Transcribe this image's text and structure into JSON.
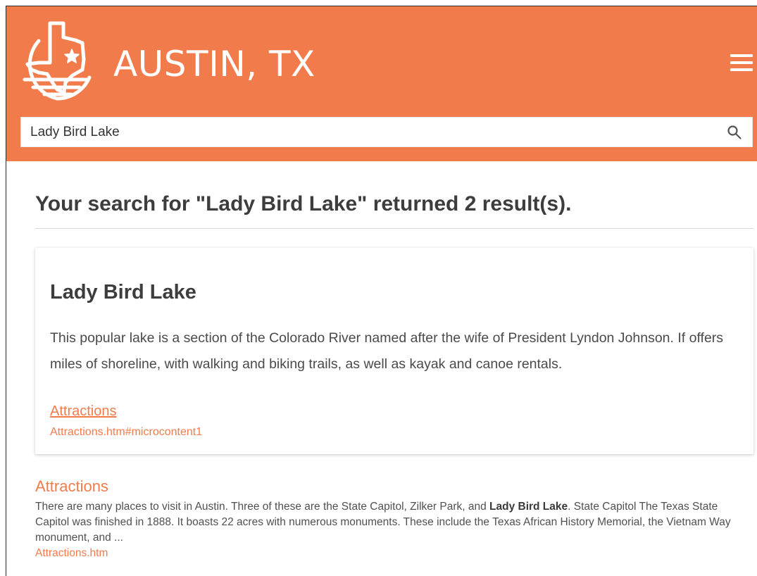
{
  "header": {
    "site_title": "AUSTIN, TX",
    "logo_icon": "texas-star-logo-icon",
    "menu_icon": "hamburger-menu-icon",
    "background_color": "#f27b4c"
  },
  "search": {
    "value": "Lady Bird Lake",
    "icon": "search-icon"
  },
  "results": {
    "heading": "Your search for \"Lady Bird Lake\" returned 2 result(s).",
    "featured": {
      "title": "Lady Bird Lake",
      "body": "This popular lake is a section of the Colorado River named after the wife of President Lyndon Johnson. If offers miles of shoreline, with walking and biking trails, as well as kayak and canoe rentals.",
      "link_label": "Attractions",
      "url": "Attractions.htm#microcontent1"
    },
    "items": [
      {
        "title": "Attractions",
        "excerpt_before": "There are many places to visit in Austin. Three of these are the State Capitol, Zilker Park, and ",
        "excerpt_highlight": "Lady Bird Lake",
        "excerpt_after": ". State Capitol The Texas State Capitol was finished in 1888. It boasts 22 acres with numerous monuments. These include the Texas African History Memorial, the Vietnam Way monument, and ...",
        "url": "Attractions.htm"
      }
    ]
  },
  "colors": {
    "accent": "#f27b4c",
    "heading_text": "#3d3d3d",
    "body_text": "#4a4a4a"
  }
}
